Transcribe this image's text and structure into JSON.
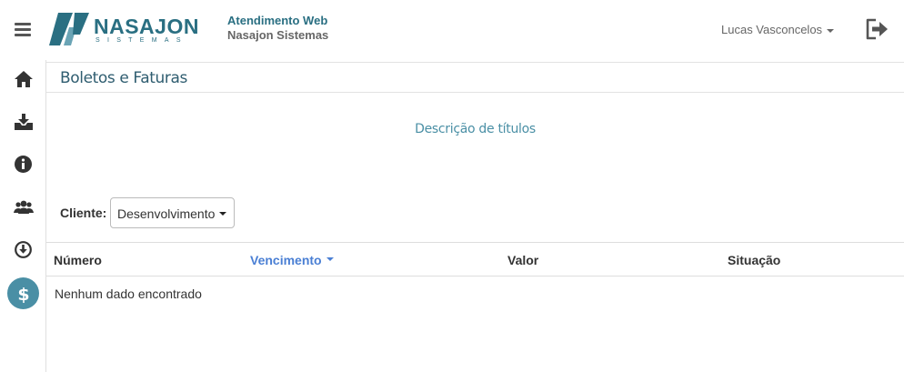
{
  "header": {
    "logo_word": "NASAJON",
    "logo_sub": "SISTEMAS",
    "app_title": "Atendimento Web",
    "app_subtitle": "Nasajon Sistemas",
    "user_name": "Lucas Vasconcelos"
  },
  "sidebar": {
    "items": [
      {
        "icon": "home-icon"
      },
      {
        "icon": "download-tray-icon"
      },
      {
        "icon": "info-icon"
      },
      {
        "icon": "users-icon"
      },
      {
        "icon": "download-circle-icon"
      },
      {
        "icon": "dollar-icon",
        "active": true
      }
    ]
  },
  "page": {
    "title": "Boletos e Faturas",
    "description": "Descrição de títulos",
    "client_label": "Cliente:",
    "client_value": "Desenvolvimento"
  },
  "table": {
    "columns": [
      "Número",
      "Vencimento",
      "Valor",
      "Situação"
    ],
    "sorted_column": "Vencimento",
    "empty_message": "Nenhum dado encontrado"
  },
  "colors": {
    "brand": "#2a6f82",
    "accent": "#4a8fa5",
    "sort_link": "#4a7fd4"
  }
}
